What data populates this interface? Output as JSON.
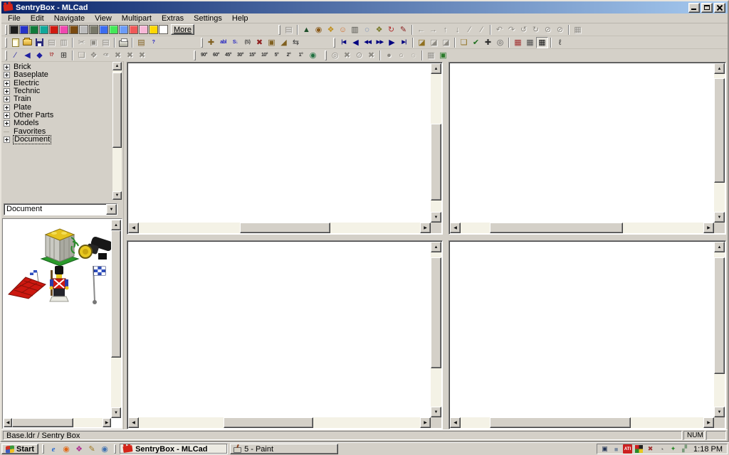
{
  "window": {
    "title": "SentryBox - MLCad"
  },
  "menu": {
    "items": [
      "File",
      "Edit",
      "Navigate",
      "View",
      "Multipart",
      "Extras",
      "Settings",
      "Help"
    ]
  },
  "palette": {
    "more_label": "More",
    "colors": [
      "#1c1c1c",
      "#2632c8",
      "#107a3a",
      "#10a89a",
      "#d01a10",
      "#f048b0",
      "#7a4a10",
      "#bcbcbc",
      "#787868",
      "#3c6cf0",
      "#44e858",
      "#6c9cf8",
      "#f05858",
      "#f8b8d8",
      "#ffd800",
      "#ffffff"
    ]
  },
  "toolbars": {
    "row1_right": [
      {
        "n": "snapshot",
        "g": "▤",
        "d": 1
      },
      "|",
      {
        "n": "select-part",
        "g": "▲",
        "c": "#1d4f2a"
      },
      {
        "n": "globe-view",
        "g": "◉",
        "c": "#8a5a1a"
      },
      {
        "n": "open-model",
        "g": "❖",
        "c": "#c09020"
      },
      {
        "n": "minifig-generator",
        "g": "☺",
        "c": "#d07030"
      },
      {
        "n": "train",
        "g": "▥",
        "c": "#50504a"
      },
      {
        "n": "loop-view",
        "g": "◌",
        "c": "#3a62a8"
      },
      {
        "n": "pieces",
        "g": "❖",
        "c": "#7a7a2a"
      },
      {
        "n": "rotate-model",
        "g": "↻",
        "c": "#b03030"
      },
      {
        "n": "paint",
        "g": "✎",
        "c": "#8a2020"
      },
      "|",
      {
        "n": "move-left",
        "g": "←",
        "d": 1
      },
      {
        "n": "move-right",
        "g": "→",
        "d": 1
      },
      {
        "n": "move-up",
        "g": "↑",
        "d": 1
      },
      {
        "n": "move-down",
        "g": "↓",
        "d": 1
      },
      {
        "n": "tilt-left",
        "g": "∕",
        "d": 1
      },
      {
        "n": "tilt-right",
        "g": "∕",
        "d": 1
      },
      "|",
      {
        "n": "rotate-x-neg",
        "g": "↶",
        "d": 1
      },
      {
        "n": "rotate-x-pos",
        "g": "↷",
        "d": 1
      },
      {
        "n": "rotate-y-neg",
        "g": "↺",
        "d": 1
      },
      {
        "n": "rotate-y-pos",
        "g": "↻",
        "d": 1
      },
      {
        "n": "rotate-z-neg",
        "g": "⊘",
        "d": 1
      },
      {
        "n": "rotate-z-pos",
        "g": "⊘",
        "d": 1
      },
      "|",
      {
        "n": "camera",
        "g": "▦",
        "d": 1
      }
    ],
    "row2_file": [
      {
        "n": "new-file",
        "cls": "ico-new"
      },
      {
        "n": "open-file",
        "cls": "ico-open"
      },
      {
        "n": "save-file",
        "cls": "ico-save"
      },
      {
        "n": "import",
        "g": "▤",
        "d": 1
      },
      {
        "n": "export",
        "g": "▥",
        "d": 1
      },
      "|",
      {
        "n": "cut",
        "g": "✂",
        "d": 1
      },
      {
        "n": "copy",
        "g": "▣",
        "d": 1
      },
      {
        "n": "paste",
        "g": "▤",
        "d": 1
      },
      "|",
      {
        "n": "print",
        "cls": "ico-print"
      },
      "|",
      {
        "n": "scan-parts",
        "g": "▤",
        "c": "#806020"
      },
      {
        "n": "context-help",
        "g": "?",
        "c": "#2020c0",
        "t": 1
      }
    ],
    "row2_edit": [
      {
        "n": "add-part",
        "g": "✚",
        "c": "#806020"
      },
      {
        "n": "add-comment",
        "g": "abl",
        "c": "#2020c0",
        "t": 1
      },
      {
        "n": "add-step",
        "g": "S↓",
        "c": "#2020c0",
        "t": 1
      },
      {
        "n": "add-rotation-step",
        "g": "(S)",
        "c": "#404040",
        "t": 1
      },
      {
        "n": "delete",
        "g": "✖",
        "c": "#902020"
      },
      {
        "n": "duplicate",
        "g": "▣",
        "c": "#806020"
      },
      {
        "n": "slope-part",
        "g": "◢",
        "c": "#806020"
      },
      {
        "n": "exchange",
        "g": "⇆",
        "c": "#404040"
      }
    ],
    "row2_nav": [
      {
        "n": "nav-first",
        "g": "|◀",
        "c": "#000080",
        "t": 1
      },
      {
        "n": "nav-prev",
        "g": "◀",
        "c": "#000080"
      },
      {
        "n": "nav-prev-step",
        "g": "◀◀",
        "c": "#000080",
        "t": 1
      },
      {
        "n": "nav-next-step",
        "g": "▶▶",
        "c": "#000080",
        "t": 1
      },
      {
        "n": "nav-next",
        "g": "▶",
        "c": "#000080"
      },
      {
        "n": "nav-last",
        "g": "▶|",
        "c": "#000080",
        "t": 1
      },
      "|",
      {
        "n": "view-mode",
        "g": "◪",
        "c": "#907020"
      },
      {
        "n": "view-hide",
        "g": "◪",
        "d": 1
      },
      {
        "n": "view-show",
        "g": "◪",
        "d": 1
      },
      "|",
      {
        "n": "place-mode",
        "g": "❏",
        "c": "#907020"
      },
      {
        "n": "draw-mode",
        "g": "✔",
        "c": "#207020"
      },
      {
        "n": "move-mode",
        "g": "✚",
        "c": "#303030"
      },
      {
        "n": "zoom-mode",
        "g": "◎",
        "c": "#606060"
      },
      "|",
      {
        "n": "grid-coarse",
        "g": "▦",
        "c": "#a03030"
      },
      {
        "n": "grid-medium",
        "g": "▦",
        "c": "#505050"
      },
      {
        "n": "grid-fine",
        "g": "▦",
        "c": "#101010",
        "p": 1
      },
      "|",
      {
        "n": "measure",
        "g": "ℓ",
        "c": "#303030"
      }
    ],
    "row3_draw": [
      {
        "n": "draw-line",
        "g": "∕",
        "c": "#2020a0"
      },
      {
        "n": "draw-triangle",
        "g": "◀",
        "c": "#2020a0"
      },
      {
        "n": "draw-quad",
        "g": "◆",
        "c": "#2020a0"
      },
      {
        "n": "draw-condline",
        "g": "\\?",
        "c": "#a02020",
        "t": 1
      },
      {
        "n": "edit-matrix",
        "g": "⊞",
        "c": "#303030"
      },
      "|",
      {
        "n": "group-create",
        "g": "❏",
        "d": 1
      },
      {
        "n": "group-edit",
        "g": "❖",
        "d": 1
      },
      {
        "n": "group-explode",
        "g": "<e",
        "d": 1,
        "t": 1
      },
      {
        "n": "mirror-x",
        "g": "✖",
        "d": 1
      },
      {
        "n": "mirror-y",
        "g": "✖",
        "d": 1
      },
      {
        "n": "mirror-z",
        "g": "✖",
        "d": 1
      }
    ],
    "row3_rotate": [
      {
        "n": "rotate-90",
        "g": "90°",
        "c": "#303030",
        "t": 1
      },
      {
        "n": "rotate-60",
        "g": "60°",
        "c": "#303030",
        "t": 1
      },
      {
        "n": "rotate-45",
        "g": "45°",
        "c": "#303030",
        "t": 1
      },
      {
        "n": "rotate-30",
        "g": "30°",
        "c": "#303030",
        "t": 1
      },
      {
        "n": "rotate-15",
        "g": "15°",
        "c": "#303030",
        "t": 1
      },
      {
        "n": "rotate-10",
        "g": "10°",
        "c": "#303030",
        "t": 1
      },
      {
        "n": "rotate-5",
        "g": "5°",
        "c": "#303030",
        "t": 1
      },
      {
        "n": "rotate-2",
        "g": "2°",
        "c": "#303030",
        "t": 1
      },
      {
        "n": "rotate-1",
        "g": "1°",
        "c": "#303030",
        "t": 1
      },
      {
        "n": "rotate-custom",
        "g": "◉",
        "c": "#207040"
      }
    ],
    "row3_misc": [
      {
        "n": "spotlight",
        "g": "◎",
        "d": 1
      },
      {
        "n": "spotlight-delete",
        "g": "✖",
        "d": 1
      },
      {
        "n": "timer",
        "g": "⊙",
        "d": 1
      },
      {
        "n": "timer-delete",
        "g": "✖",
        "d": 1
      },
      "|",
      {
        "n": "bulb-on",
        "g": "●",
        "d": 1
      },
      {
        "n": "bulb-off",
        "g": "○",
        "d": 1
      },
      {
        "n": "loop",
        "g": "◌",
        "d": 1
      },
      "|",
      {
        "n": "grid-display",
        "g": "▦",
        "d": 1
      },
      {
        "n": "render-view",
        "g": "▣",
        "c": "#2a7a2a"
      }
    ]
  },
  "partsTree": {
    "items": [
      {
        "label": "Brick",
        "plus": true
      },
      {
        "label": "Baseplate",
        "plus": true
      },
      {
        "label": "Electric",
        "plus": true
      },
      {
        "label": "Technic",
        "plus": true
      },
      {
        "label": "Train",
        "plus": true
      },
      {
        "label": "Plate",
        "plus": true
      },
      {
        "label": "Other Parts",
        "plus": true
      },
      {
        "label": "Models",
        "plus": true
      },
      {
        "label": "Favorites",
        "plus": false
      },
      {
        "label": "Document",
        "plus": true
      }
    ],
    "selected": "Document"
  },
  "combo": {
    "value": "Document"
  },
  "statusbar": {
    "message": "Base.ldr / Sentry Box",
    "num_indicator": "NUM"
  },
  "taskbar": {
    "start_label": "Start",
    "quicklaunch": [
      {
        "n": "internet-explorer",
        "g": "e",
        "c": "#2a6ad0",
        "t": 1
      },
      {
        "n": "browser",
        "g": "◉",
        "c": "#e06818"
      },
      {
        "n": "quicklaunch-3",
        "g": "❖",
        "c": "#b03090"
      },
      {
        "n": "pen-tool",
        "g": "✎",
        "c": "#a07820"
      },
      {
        "n": "media-player",
        "g": "◉",
        "c": "#4070b0"
      }
    ],
    "tasks": [
      {
        "label": "SentryBox - MLCad",
        "icon": "brick",
        "active": true
      },
      {
        "label": "5 - Paint",
        "icon": "paint",
        "active": false
      }
    ],
    "tray": [
      {
        "n": "tray-1",
        "g": "▣",
        "c": "#223355"
      },
      {
        "n": "tray-2",
        "g": "■",
        "c": "#7a8aa0"
      },
      {
        "n": "tray-ati",
        "g": "ATI",
        "c": "#ffffff",
        "bg": "#cc2020"
      },
      {
        "n": "tray-colors",
        "cls": "ico-quad"
      },
      {
        "n": "tray-volume-muted",
        "g": "✖",
        "c": "#a03030"
      },
      {
        "n": "tray-update",
        "g": "◔",
        "c": "#606060"
      },
      {
        "n": "tray-scheduler",
        "g": "✦",
        "c": "#2a8a2a"
      },
      {
        "n": "tray-usb",
        "g": "▞",
        "c": "#7a9a7a"
      }
    ],
    "clock": "1:18 PM"
  }
}
